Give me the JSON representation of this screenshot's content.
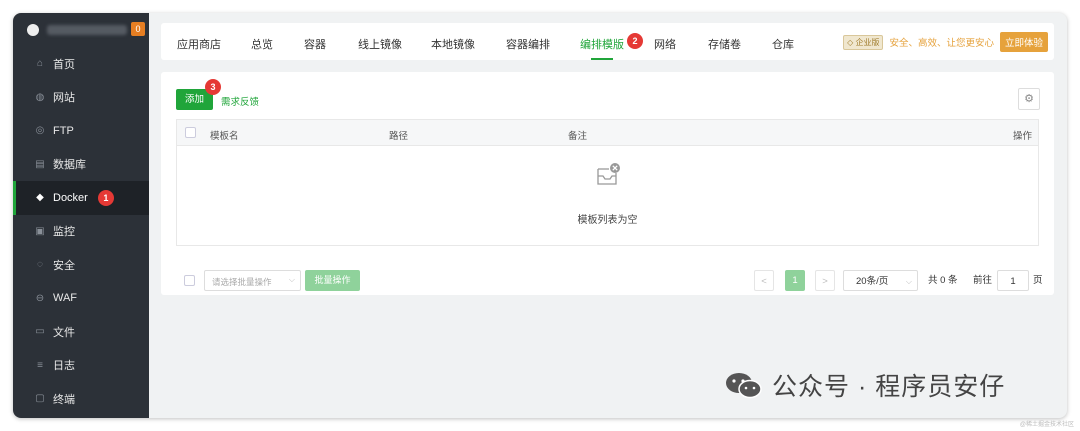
{
  "sidebar": {
    "server_count": "0",
    "items": [
      {
        "label": "首页",
        "icon": "home-icon"
      },
      {
        "label": "网站",
        "icon": "globe-icon"
      },
      {
        "label": "FTP",
        "icon": "ftp-icon"
      },
      {
        "label": "数据库",
        "icon": "database-icon"
      },
      {
        "label": "Docker",
        "icon": "docker-icon",
        "badge": "1"
      },
      {
        "label": "监控",
        "icon": "monitor-icon"
      },
      {
        "label": "安全",
        "icon": "shield-icon"
      },
      {
        "label": "WAF",
        "icon": "waf-icon"
      },
      {
        "label": "文件",
        "icon": "folder-icon"
      },
      {
        "label": "日志",
        "icon": "log-icon"
      },
      {
        "label": "终端",
        "icon": "terminal-icon"
      }
    ]
  },
  "tabs": {
    "items": [
      "应用商店",
      "总览",
      "容器",
      "线上镜像",
      "本地镜像",
      "容器编排",
      "编排模版",
      "网络",
      "存储卷",
      "仓库"
    ],
    "active_badge": "2"
  },
  "enterprise": {
    "tag": "企业版",
    "text": "安全、高效、让您更安心",
    "button": "立即体验"
  },
  "toolbar": {
    "add_label": "添加",
    "add_badge": "3",
    "feedback_label": "需求反馈"
  },
  "table": {
    "columns": [
      "模板名",
      "路径",
      "备注",
      "操作"
    ],
    "empty_text": "模板列表为空"
  },
  "footer": {
    "batch_placeholder": "请选择批量操作",
    "batch_button": "批量操作",
    "prev": "<",
    "current_page": "1",
    "next": ">",
    "page_size": "20条/页",
    "total": "共 0 条",
    "goto_label": "前往",
    "goto_value": "1",
    "page_unit": "页"
  },
  "watermark": {
    "text": "公众号 · 程序员安仔",
    "small": "@稀土掘金技术社区"
  },
  "colors": {
    "accent": "#20a53a",
    "sidebar_bg": "#2c3138",
    "badge_red": "#e53935",
    "enterprise_orange": "#e6a23c"
  }
}
